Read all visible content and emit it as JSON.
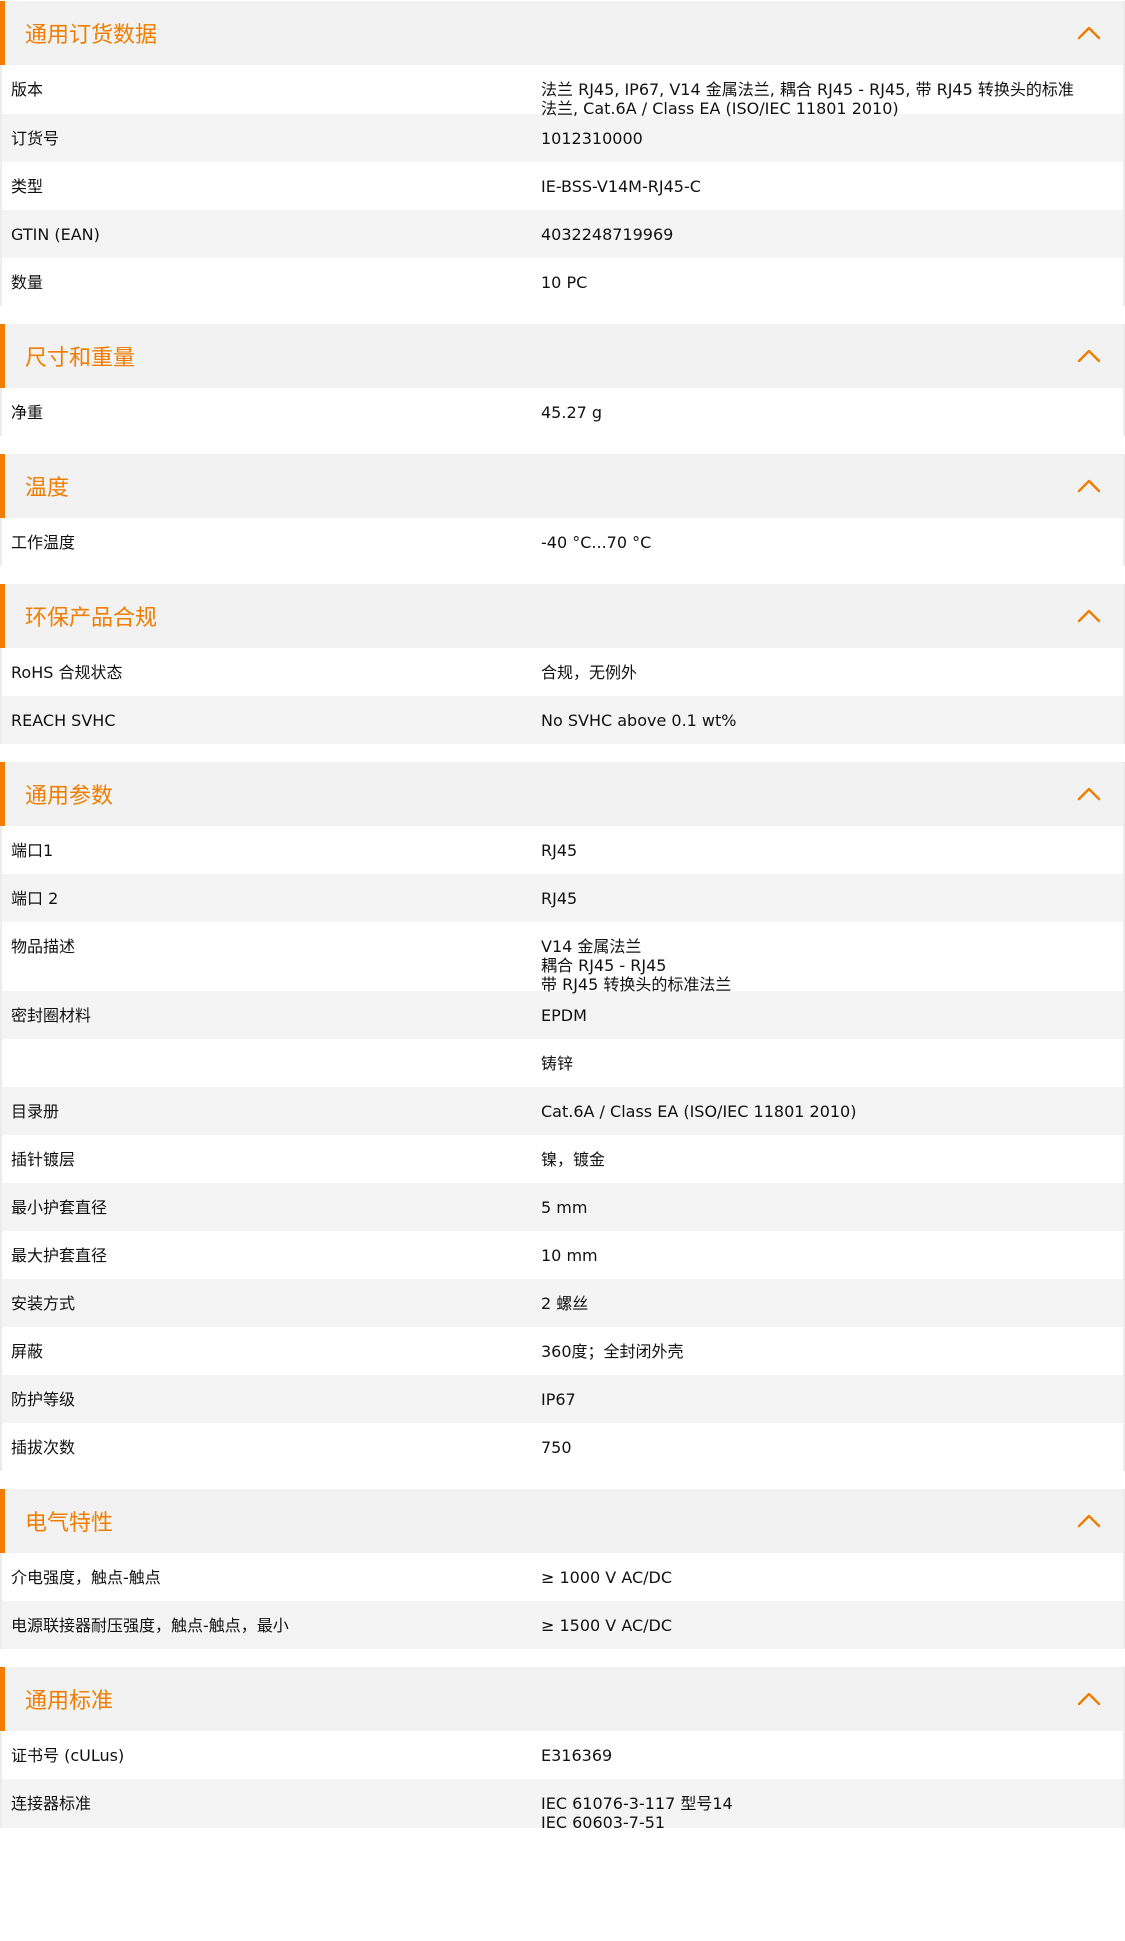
{
  "sections": [
    {
      "title": "通用订货数据",
      "collapse_icon": "chevron-up-icon",
      "rows": [
        {
          "label": "版本",
          "value_lines": [
            "法兰 RJ45, IP67, V14 金属法兰, 耦合 RJ45 - RJ45, 带 RJ45 转换头的标准",
            "法兰, Cat.6A / Class EA (ISO/IEC 11801 2010)"
          ]
        },
        {
          "label": "订货号",
          "value_lines": [
            "1012310000"
          ]
        },
        {
          "label": "类型",
          "value_lines": [
            "IE-BSS-V14M-RJ45-C"
          ]
        },
        {
          "label": "GTIN (EAN)",
          "value_lines": [
            "4032248719969"
          ]
        },
        {
          "label": "数量",
          "value_lines": [
            "10  PC"
          ]
        }
      ]
    },
    {
      "title": "尺寸和重量",
      "collapse_icon": "chevron-up-icon",
      "rows": [
        {
          "label": "净重",
          "value_lines": [
            "45.27  g"
          ]
        }
      ]
    },
    {
      "title": "温度",
      "collapse_icon": "chevron-up-icon",
      "rows": [
        {
          "label": "工作温度",
          "value_lines": [
            "-40 °C...70 °C"
          ]
        }
      ]
    },
    {
      "title": "环保产品合规",
      "collapse_icon": "chevron-up-icon",
      "rows": [
        {
          "label": "RoHS 合规状态",
          "value_lines": [
            "合规，无例外"
          ]
        },
        {
          "label": "REACH SVHC",
          "value_lines": [
            "No SVHC above 0.1 wt%"
          ]
        }
      ]
    },
    {
      "title": "通用参数",
      "collapse_icon": "chevron-up-icon",
      "rows": [
        {
          "label": "端口1",
          "value_lines": [
            "RJ45"
          ]
        },
        {
          "label": "端口 2",
          "value_lines": [
            "RJ45"
          ]
        },
        {
          "label": "物品描述",
          "value_lines": [
            "V14 金属法兰",
            "耦合 RJ45 - RJ45",
            "带 RJ45 转换头的标准法兰"
          ]
        },
        {
          "label": "密封圈材料",
          "value_lines": [
            "EPDM"
          ]
        },
        {
          "label": "",
          "value_lines": [
            "铸锌"
          ]
        },
        {
          "label": "目录册",
          "value_lines": [
            "Cat.6A / Class EA (ISO/IEC 11801 2010)"
          ]
        },
        {
          "label": "插针镀层",
          "value_lines": [
            "镍，镀金"
          ]
        },
        {
          "label": "最小护套直径",
          "value_lines": [
            "5  mm"
          ]
        },
        {
          "label": "最大护套直径",
          "value_lines": [
            "10  mm"
          ]
        },
        {
          "label": "安装方式",
          "value_lines": [
            "2 螺丝"
          ]
        },
        {
          "label": "屏蔽",
          "value_lines": [
            "360度；全封闭外壳"
          ]
        },
        {
          "label": "防护等级",
          "value_lines": [
            "IP67"
          ]
        },
        {
          "label": "插拔次数",
          "value_lines": [
            "750"
          ]
        }
      ]
    },
    {
      "title": "电气特性",
      "collapse_icon": "chevron-up-icon",
      "rows": [
        {
          "label": "介电强度，触点-触点",
          "value_lines": [
            "≥ 1000 V AC/DC"
          ]
        },
        {
          "label": "电源联接器耐压强度，触点-触点，最小",
          "value_lines": [
            "≥ 1500 V AC/DC"
          ]
        }
      ]
    },
    {
      "title": "通用标准",
      "collapse_icon": "chevron-up-icon",
      "rows": [
        {
          "label": "证书号 (cULus)",
          "value_lines": [
            "E316369"
          ]
        },
        {
          "label": "连接器标准",
          "value_lines": [
            "IEC 61076-3-117 型号14",
            "IEC 60603-7-51"
          ]
        }
      ]
    }
  ],
  "colors": {
    "accent": "#f07d00",
    "header_bg": "#f2f2f2",
    "row_white": "#ffffff",
    "row_grey": "#f4f4f4",
    "text": "#111111"
  }
}
